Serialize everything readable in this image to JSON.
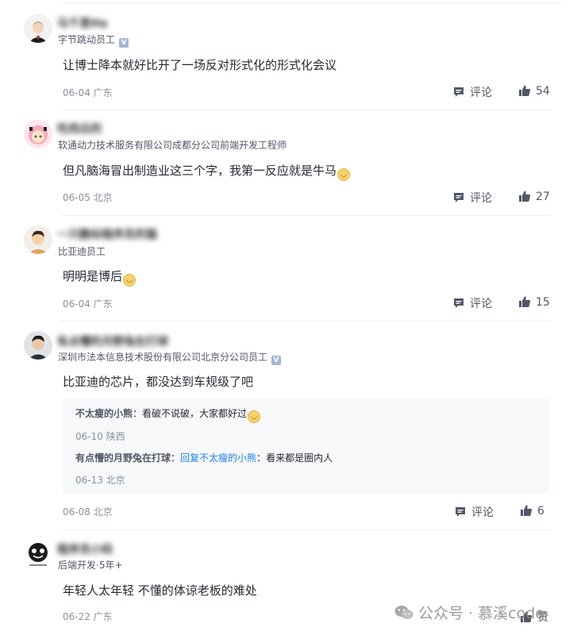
{
  "labels": {
    "comment": "评论",
    "like": "赞"
  },
  "comments": [
    {
      "username": "马千里Ha",
      "job": "字节跳动员工",
      "verified": true,
      "text": "让博士降本就好比开了一场反对形式化的形式化会议",
      "emoji": false,
      "date": "06-04 广东",
      "likes": "54"
    },
    {
      "username": "吃西瓜的",
      "job": "软通动力技术服务有限公司成都分公司前端开发工程师",
      "verified": false,
      "text": "但凡脑海冒出制造业这三个字，我第一反应就是牛马",
      "emoji": true,
      "date": "06-05 北京",
      "likes": "27"
    },
    {
      "username": "一只酷似程序员的猫",
      "job": "比亚迪员工",
      "verified": false,
      "text": "明明是博后",
      "emoji": true,
      "date": "06-04 广东",
      "likes": "15"
    },
    {
      "username": "有点懵的月野兔在打球",
      "job": "深圳市法本信息技术股份有限公司北京分公司员工",
      "verified": true,
      "text": "比亚迪的芯片，都没达到车规级了吧",
      "emoji": false,
      "date": "06-08 北京",
      "likes": "6",
      "replies": [
        {
          "author": "不太瘦的小熊",
          "sep": "：",
          "reply_to": "",
          "text": "看破不说破，大家都好过",
          "emoji": true,
          "date": "06-10 陕西"
        },
        {
          "author": "有点懵的月野兔在打球",
          "sep": "：",
          "reply_to": "回复不太瘦的小熊",
          "text": "看来都是圈内人",
          "emoji": false,
          "date": "06-13 北京"
        }
      ]
    },
    {
      "username": "程序员小码",
      "job": "后端开发·5年+",
      "verified": false,
      "text": "年轻人太年轻 不懂的体谅老板的难处",
      "emoji": false,
      "date": "06-22 广东",
      "likes": ""
    }
  ],
  "watermark": {
    "text": "公众号 · 慕溪code"
  },
  "colors": {
    "link": "#1e80ff",
    "meta": "#8a919f",
    "reply_bg": "#f7f8fa"
  },
  "icons": {
    "comment": "comment-icon",
    "like": "thumbs-up-icon",
    "verified": "verified-badge-icon"
  }
}
